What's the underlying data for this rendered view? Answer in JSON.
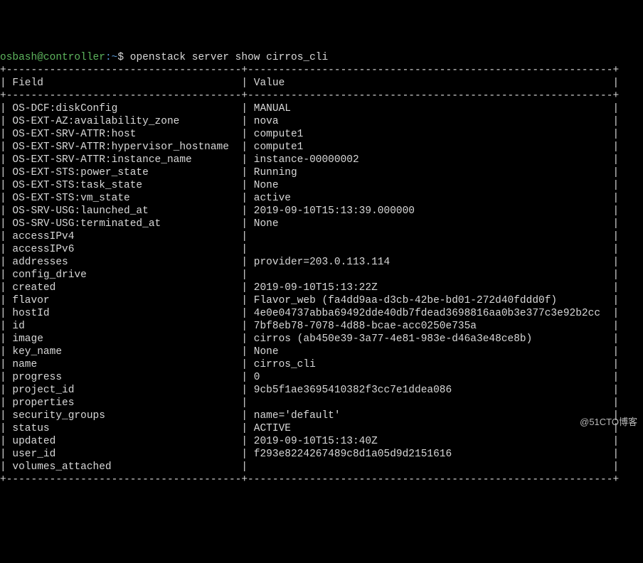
{
  "prompt": {
    "user": "osbash",
    "at": "@",
    "host": "controller",
    "colon": ":",
    "path": "~",
    "dollar": "$",
    "command": "openstack server show cirros_cli"
  },
  "table": {
    "header_field": "Field",
    "header_value": "Value",
    "rows": [
      {
        "field": "OS-DCF:diskConfig",
        "value": "MANUAL"
      },
      {
        "field": "OS-EXT-AZ:availability_zone",
        "value": "nova"
      },
      {
        "field": "OS-EXT-SRV-ATTR:host",
        "value": "compute1"
      },
      {
        "field": "OS-EXT-SRV-ATTR:hypervisor_hostname",
        "value": "compute1"
      },
      {
        "field": "OS-EXT-SRV-ATTR:instance_name",
        "value": "instance-00000002"
      },
      {
        "field": "OS-EXT-STS:power_state",
        "value": "Running"
      },
      {
        "field": "OS-EXT-STS:task_state",
        "value": "None"
      },
      {
        "field": "OS-EXT-STS:vm_state",
        "value": "active"
      },
      {
        "field": "OS-SRV-USG:launched_at",
        "value": "2019-09-10T15:13:39.000000"
      },
      {
        "field": "OS-SRV-USG:terminated_at",
        "value": "None"
      },
      {
        "field": "accessIPv4",
        "value": ""
      },
      {
        "field": "accessIPv6",
        "value": ""
      },
      {
        "field": "addresses",
        "value": "provider=203.0.113.114"
      },
      {
        "field": "config_drive",
        "value": ""
      },
      {
        "field": "created",
        "value": "2019-09-10T15:13:22Z"
      },
      {
        "field": "flavor",
        "value": "Flavor_web (fa4dd9aa-d3cb-42be-bd01-272d40fddd0f)"
      },
      {
        "field": "hostId",
        "value": "4e0e04737abba69492dde40db7fdead3698816aa0b3e377c3e92b2cc"
      },
      {
        "field": "id",
        "value": "7bf8eb78-7078-4d88-bcae-acc0250e735a"
      },
      {
        "field": "image",
        "value": "cirros (ab450e39-3a77-4e81-983e-d46a3e48ce8b)"
      },
      {
        "field": "key_name",
        "value": "None"
      },
      {
        "field": "name",
        "value": "cirros_cli"
      },
      {
        "field": "progress",
        "value": "0"
      },
      {
        "field": "project_id",
        "value": "9cb5f1ae3695410382f3cc7e1ddea086"
      },
      {
        "field": "properties",
        "value": ""
      },
      {
        "field": "security_groups",
        "value": "name='default'"
      },
      {
        "field": "status",
        "value": "ACTIVE"
      },
      {
        "field": "updated",
        "value": "2019-09-10T15:13:40Z"
      },
      {
        "field": "user_id",
        "value": "f293e8224267489c8d1a05d9d2151616"
      },
      {
        "field": "volumes_attached",
        "value": ""
      }
    ]
  },
  "col_widths": {
    "field": 37,
    "value": 58
  },
  "watermark": "@51CTO博客"
}
